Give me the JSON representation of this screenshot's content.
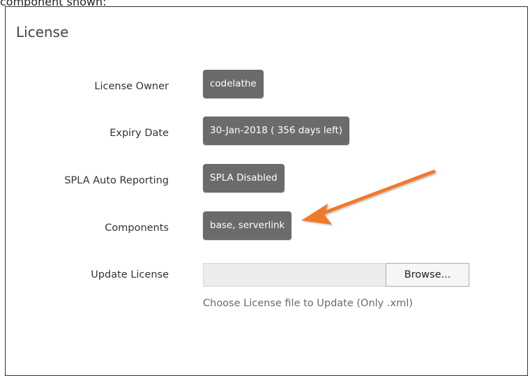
{
  "top_caption": "component shown:",
  "license_panel": {
    "title": "License",
    "fields": {
      "license_owner": {
        "label": "License Owner",
        "value": "codelathe"
      },
      "expiry_date": {
        "label": "Expiry Date",
        "value": "30-Jan-2018 ( 356 days left)"
      },
      "spla_auto_reporting": {
        "label": "SPLA Auto Reporting",
        "value": "SPLA Disabled"
      },
      "components": {
        "label": "Components",
        "value": "base, serverlink"
      }
    },
    "update_license": {
      "label": "Update License",
      "file_input_value": "",
      "browse_label": "Browse...",
      "help_text": "Choose License file to Update (Only .xml)"
    }
  },
  "annotation": {
    "arrow_color": "#f07a2c",
    "arrow_icon": "callout-arrow-icon"
  }
}
